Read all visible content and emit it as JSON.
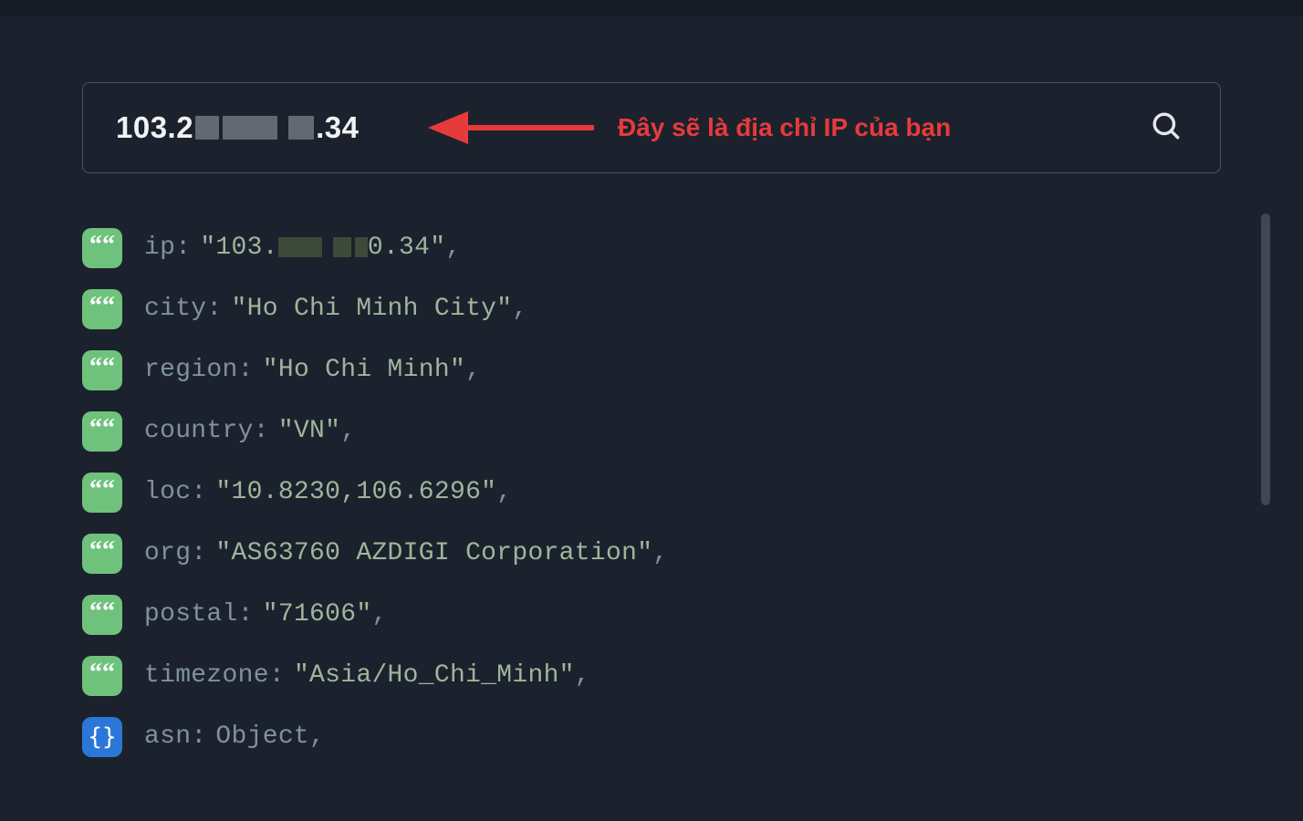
{
  "search": {
    "ip_prefix": "103.",
    "ip_mid_visible": "2",
    "ip_suffix": ".34",
    "annotation": "Đây sẽ là địa chỉ IP của bạn"
  },
  "rows": [
    {
      "type": "string",
      "key": "ip",
      "value_prefix": "\"103.",
      "value_suffix": "0.34\"",
      "masked": true
    },
    {
      "type": "string",
      "key": "city",
      "value": "\"Ho Chi Minh City\""
    },
    {
      "type": "string",
      "key": "region",
      "value": "\"Ho Chi Minh\""
    },
    {
      "type": "string",
      "key": "country",
      "value": "\"VN\""
    },
    {
      "type": "string",
      "key": "loc",
      "value": "\"10.8230,106.6296\""
    },
    {
      "type": "string",
      "key": "org",
      "value": "\"AS63760 AZDIGI Corporation\""
    },
    {
      "type": "string",
      "key": "postal",
      "value": "\"71606\""
    },
    {
      "type": "string",
      "key": "timezone",
      "value": "\"Asia/Ho_Chi_Minh\""
    },
    {
      "type": "object",
      "key": "asn",
      "value": "Object"
    }
  ],
  "badge_glyphs": {
    "string": "““",
    "object": "{}"
  },
  "comma": ","
}
